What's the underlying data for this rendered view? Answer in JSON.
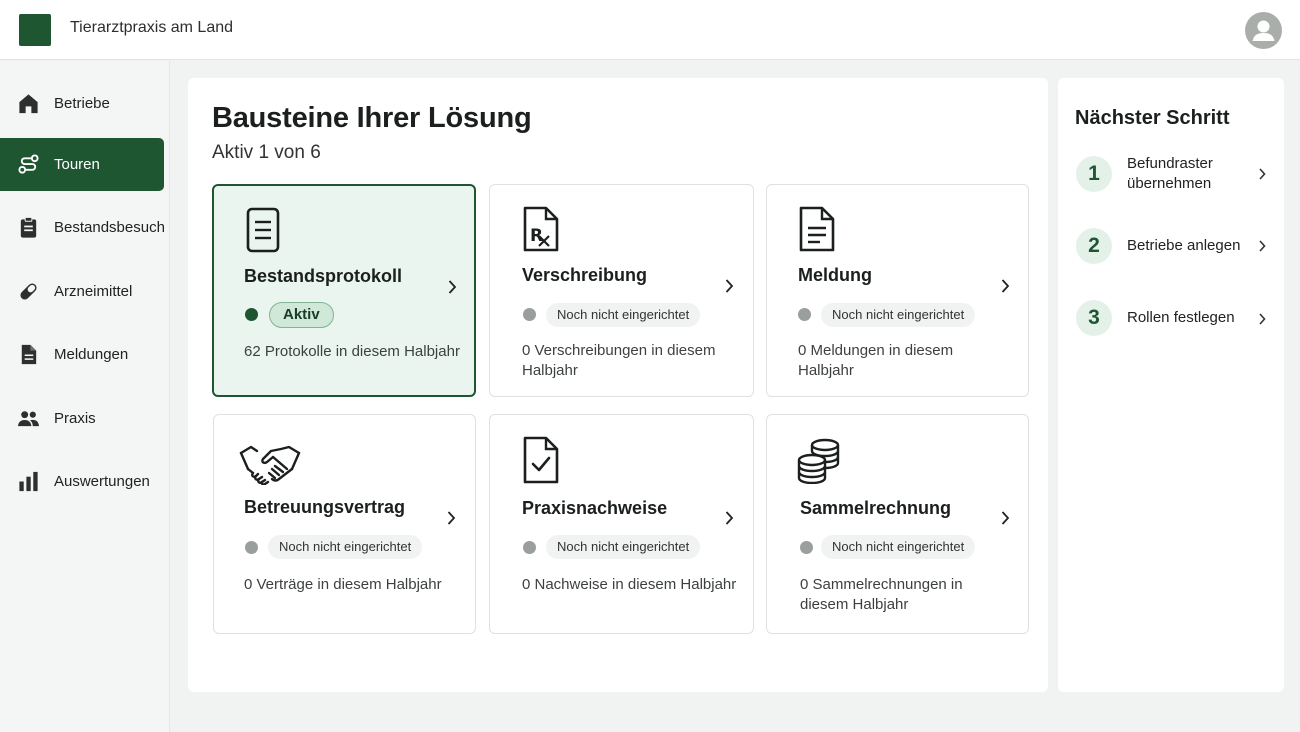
{
  "app": {
    "title": "Tierarztpraxis am Land"
  },
  "sidebar": {
    "items": [
      {
        "label": "Betriebe",
        "icon": "home-icon",
        "active": false
      },
      {
        "label": "Touren",
        "icon": "route-icon",
        "active": true
      },
      {
        "label": "Bestandsbesuch",
        "icon": "clipboard-icon",
        "active": false
      },
      {
        "label": "Arzneimittel",
        "icon": "pill-icon",
        "active": false
      },
      {
        "label": "Meldungen",
        "icon": "document-icon",
        "active": false
      },
      {
        "label": "Praxis",
        "icon": "people-icon",
        "active": false
      },
      {
        "label": "Auswertungen",
        "icon": "bar-chart-icon",
        "active": false
      }
    ]
  },
  "main": {
    "title": "Bausteine Ihrer Lösung",
    "subtitle": "Aktiv 1 von 6",
    "cards": [
      {
        "title": "Bestandsprotokoll",
        "status": "Aktiv",
        "active": true,
        "description": "62 Protokolle in diesem Halbjahr",
        "icon": "document-lines-icon"
      },
      {
        "title": "Verschreibung",
        "status": "Noch nicht eingerichtet",
        "active": false,
        "description": "0 Verschreibungen in diesem Halbjahr",
        "icon": "prescription-icon"
      },
      {
        "title": "Meldung",
        "status": "Noch nicht eingerichtet",
        "active": false,
        "description": "0 Meldungen in diesem Halbjahr",
        "icon": "report-document-icon"
      },
      {
        "title": "Betreuungsvertrag",
        "status": "Noch nicht eingerichtet",
        "active": false,
        "description": "0 Verträge in diesem Halbjahr",
        "icon": "handshake-icon"
      },
      {
        "title": "Praxisnachweise",
        "status": "Noch nicht eingerichtet",
        "active": false,
        "description": "0 Nachweise in diesem Halbjahr",
        "icon": "document-check-icon"
      },
      {
        "title": "Sammelrechnung",
        "status": "Noch nicht eingerichtet",
        "active": false,
        "description": "0 Sammelrechnungen in diesem Halbjahr",
        "icon": "coins-stack-icon"
      }
    ]
  },
  "next_step": {
    "title": "Nächster Schritt",
    "steps": [
      {
        "number": "1",
        "label": "Befundraster übernehmen"
      },
      {
        "number": "2",
        "label": "Betriebe anlegen"
      },
      {
        "number": "3",
        "label": "Rollen festlegen"
      }
    ]
  },
  "colors": {
    "brand": "#1e5631",
    "active_card_bg": "#e9f5ee",
    "inactive_dot": "#9a9e9c"
  }
}
